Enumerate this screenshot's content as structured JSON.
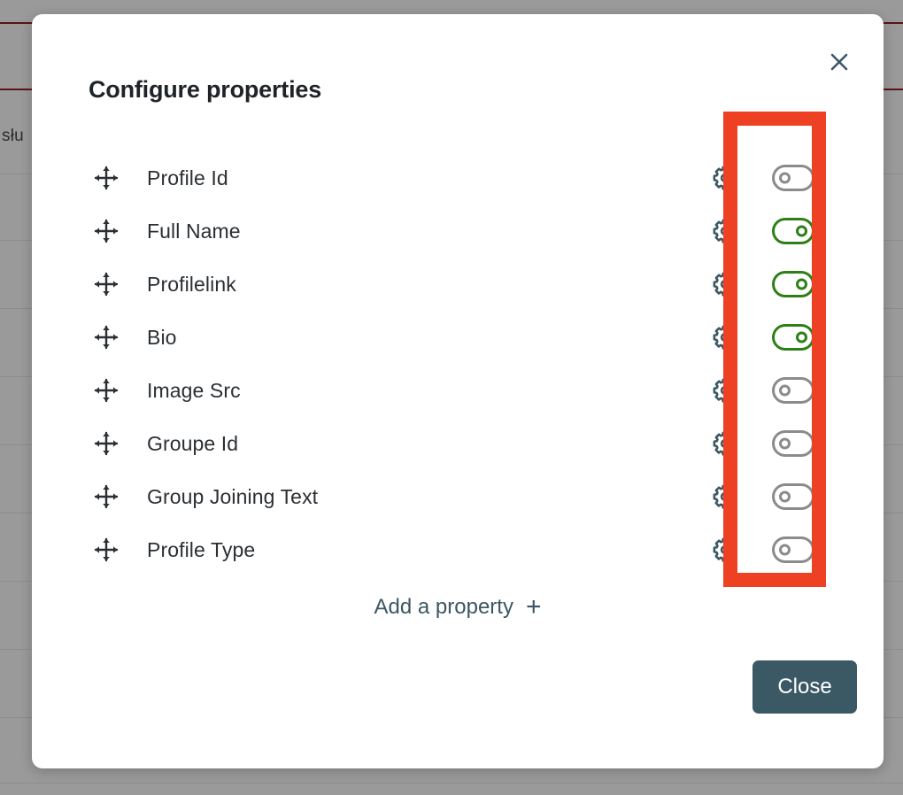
{
  "background": {
    "visible_text": "słu",
    "overlay_color": "#9a9a9a",
    "accent_line_color": "#5c1512"
  },
  "modal": {
    "title": "Configure properties",
    "close_icon": "close-x-icon",
    "properties": [
      {
        "label": "Profile Id",
        "drag_icon": "move-arrows-icon",
        "settings_icon": "gear-icon",
        "enabled": false
      },
      {
        "label": "Full Name",
        "drag_icon": "move-arrows-icon",
        "settings_icon": "gear-icon",
        "enabled": true
      },
      {
        "label": "Profilelink",
        "drag_icon": "move-arrows-icon",
        "settings_icon": "gear-icon",
        "enabled": true
      },
      {
        "label": "Bio",
        "drag_icon": "move-arrows-icon",
        "settings_icon": "gear-icon",
        "enabled": true
      },
      {
        "label": "Image Src",
        "drag_icon": "move-arrows-icon",
        "settings_icon": "gear-icon",
        "enabled": false
      },
      {
        "label": "Groupe Id",
        "drag_icon": "move-arrows-icon",
        "settings_icon": "gear-icon",
        "enabled": false
      },
      {
        "label": "Group Joining Text",
        "drag_icon": "move-arrows-icon",
        "settings_icon": "gear-icon",
        "enabled": false
      },
      {
        "label": "Profile Type",
        "drag_icon": "move-arrows-icon",
        "settings_icon": "gear-icon",
        "enabled": false
      }
    ],
    "add_property": {
      "label": "Add a property",
      "icon": "plus-icon"
    },
    "close_button": {
      "label": "Close"
    }
  },
  "annotation": {
    "shape": "rectangle-highlight",
    "color": "#ee4123",
    "target": "toggle-column"
  },
  "colors": {
    "toggle_on": "#2e8016",
    "toggle_off": "#8b8b8b",
    "accent_slate": "#3b5865",
    "annotation_red": "#ee4123"
  }
}
